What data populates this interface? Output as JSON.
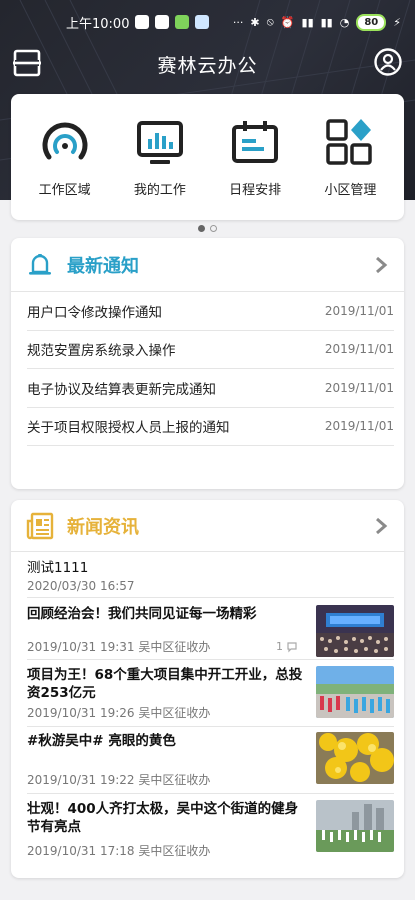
{
  "status_bar": {
    "time": "上午10:00",
    "battery": "80"
  },
  "header": {
    "title": "赛林云办公"
  },
  "quick_actions": [
    {
      "label": "工作区域",
      "icon": "signal-arc-icon"
    },
    {
      "label": "我的工作",
      "icon": "monitor-chart-icon"
    },
    {
      "label": "日程安排",
      "icon": "calendar-icon"
    },
    {
      "label": "小区管理",
      "icon": "grid-diamond-icon"
    }
  ],
  "pager": {
    "pages": 2,
    "active": 1
  },
  "notice": {
    "title": "最新通知",
    "items": [
      {
        "title": "用户口令修改操作通知",
        "date": "2019/11/01"
      },
      {
        "title": "规范安置房系统录入操作",
        "date": "2019/11/01"
      },
      {
        "title": "电子协议及结算表更新完成通知",
        "date": "2019/11/01"
      },
      {
        "title": "关于项目权限授权人员上报的通知",
        "date": "2019/11/01"
      }
    ]
  },
  "news": {
    "title": "新闻资讯",
    "items": [
      {
        "title": "测试1111",
        "meta": "2020/03/30 16:57"
      },
      {
        "title": "回顾经治会！我们共同见证每一场精彩",
        "meta": "2019/10/31 19:31 吴中区征收办",
        "comments": "1"
      },
      {
        "title": "项目为王！68个重大项目集中开工开业，总投资253亿元",
        "meta": "2019/10/31 19:26 吴中区征收办"
      },
      {
        "title": "#秋游吴中# 亮眼的黄色",
        "meta": "2019/10/31 19:22 吴中区征收办"
      },
      {
        "title": "壮观！400人齐打太极，吴中这个街道的健身节有亮点",
        "meta": "2019/10/31 17:18 吴中区征收办"
      }
    ]
  },
  "colors": {
    "notice_accent": "#2aa0c8",
    "news_accent": "#e6b23a",
    "header_bg": "#24262e"
  }
}
